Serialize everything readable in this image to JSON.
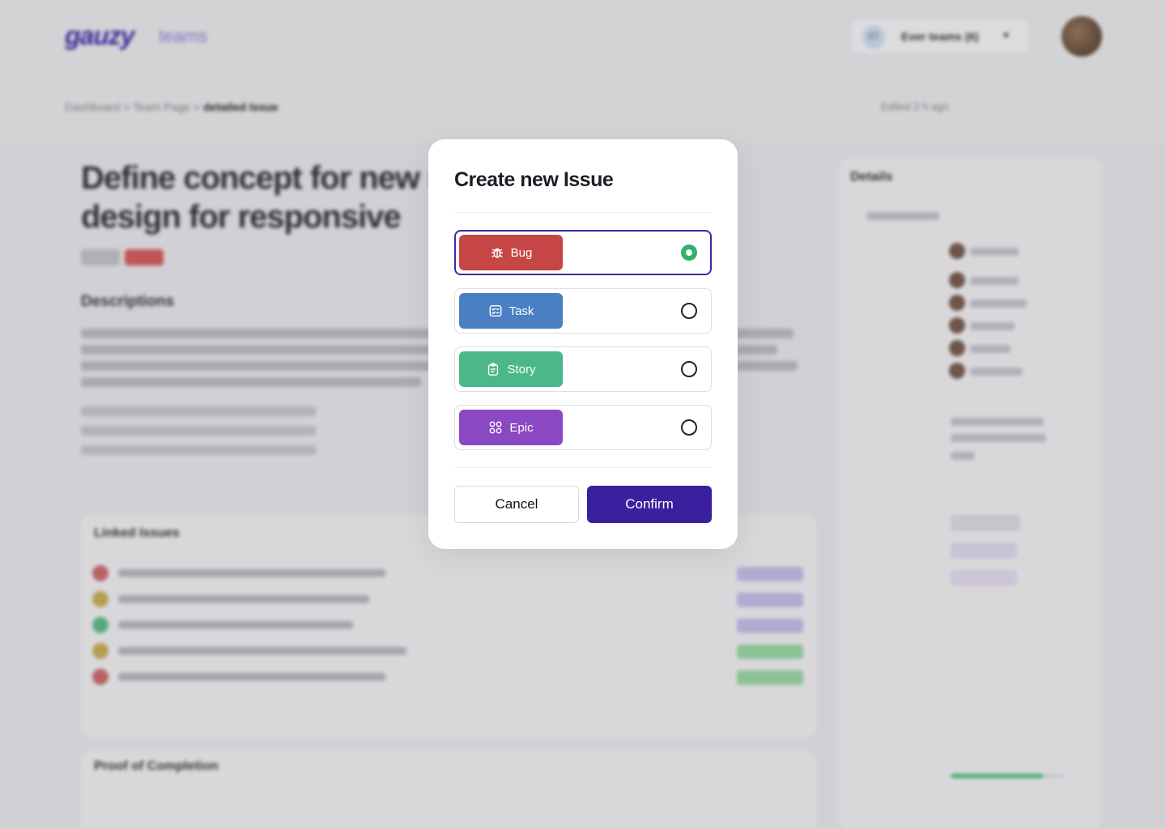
{
  "background": {
    "logo": "gauzy",
    "logo_sub": "teams",
    "team_selector": {
      "avatar": "ET",
      "name": "Ever teams (6)"
    },
    "breadcrumb": {
      "items": [
        "Dashboard",
        "Team Page"
      ],
      "current": "detailed Issue"
    },
    "topright": "Edited 2 h ago",
    "issue_title": "Define concept for new sidebar darkmode design for responsive",
    "descriptions_heading": "Descriptions",
    "linked_issues_heading": "Linked Issues",
    "proof_heading": "Proof of Completion",
    "details_heading": "Details",
    "colors": {
      "brand": "#3826a6"
    }
  },
  "modal": {
    "title": "Create new Issue",
    "options": [
      {
        "label": "Bug",
        "icon": "bug-icon",
        "color": "#c64646",
        "selected": true
      },
      {
        "label": "Task",
        "icon": "task-icon",
        "color": "#4a7fc1",
        "selected": false
      },
      {
        "label": "Story",
        "icon": "story-icon",
        "color": "#4cb88a",
        "selected": false
      },
      {
        "label": "Epic",
        "icon": "epic-icon",
        "color": "#8a48c2",
        "selected": false
      }
    ],
    "cancel_label": "Cancel",
    "confirm_label": "Confirm",
    "colors": {
      "selected_border": "#3e2aa0",
      "radio_selected": "#2eb36b",
      "confirm_bg": "#3a1f9e"
    }
  }
}
